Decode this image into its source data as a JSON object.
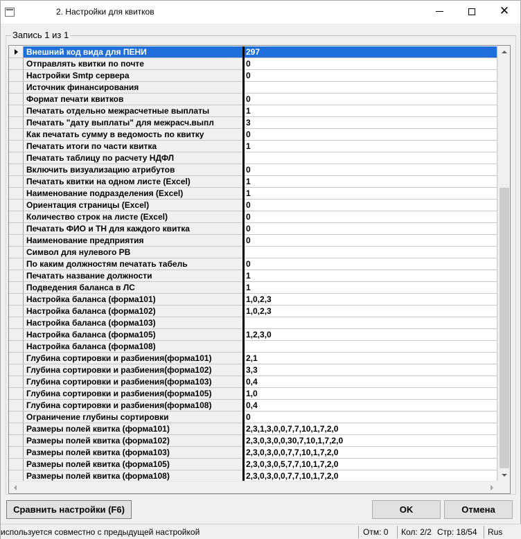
{
  "window": {
    "title": "2. Настройки для квитков"
  },
  "group": {
    "caption": "Запись 1 из 1"
  },
  "grid": {
    "rows": [
      {
        "name": "Внешний код вида для ПЕНИ",
        "value": "297"
      },
      {
        "name": "Отправлять квитки по почте",
        "value": "0"
      },
      {
        "name": "Настройки Smtp сервера",
        "value": "0"
      },
      {
        "name": "Источник финансирования",
        "value": ""
      },
      {
        "name": "Формат печати квитков",
        "value": "0"
      },
      {
        "name": "Печатать отдельно межрасчетные выплаты",
        "value": "1"
      },
      {
        "name": "Печатать \"дату выплаты\" для межрасч.выпл",
        "value": "3"
      },
      {
        "name": "Как печатать сумму в ведомость по квитку",
        "value": "0"
      },
      {
        "name": "Печатать итоги по части квитка",
        "value": "1"
      },
      {
        "name": "Печатать таблицу по расчету НДФЛ",
        "value": ""
      },
      {
        "name": "Включить визуализацию атрибутов",
        "value": "0"
      },
      {
        "name": "Печатать квитки на одном листе (Excel)",
        "value": "1"
      },
      {
        "name": "Наименование подразделения (Excel)",
        "value": "1"
      },
      {
        "name": "Ориентация страницы (Excel)",
        "value": "0"
      },
      {
        "name": "Количество строк на листе (Excel)",
        "value": "0"
      },
      {
        "name": "Печатать ФИО и ТН для каждого квитка",
        "value": "0"
      },
      {
        "name": "Наименование предприятия",
        "value": "0"
      },
      {
        "name": "Символ для нулевого РВ",
        "value": ""
      },
      {
        "name": "По каким должностям печатать табель",
        "value": "0"
      },
      {
        "name": "Печатать название должности",
        "value": "1"
      },
      {
        "name": "Подведения баланса в ЛС",
        "value": "1"
      },
      {
        "name": "Настройка баланса (форма101)",
        "value": "1,0,2,3"
      },
      {
        "name": "Настройка баланса (форма102)",
        "value": "1,0,2,3"
      },
      {
        "name": "Настройка баланса (форма103)",
        "value": ""
      },
      {
        "name": "Настройка баланса (форма105)",
        "value": "1,2,3,0"
      },
      {
        "name": "Настройка баланса (форма108)",
        "value": ""
      },
      {
        "name": "Глубина сортировки и разбиения(форма101)",
        "value": "2,1"
      },
      {
        "name": "Глубина сортировки и разбиения(форма102)",
        "value": "3,3"
      },
      {
        "name": "Глубина сортировки и разбиения(форма103)",
        "value": "0,4"
      },
      {
        "name": "Глубина сортировки и разбиения(форма105)",
        "value": "1,0"
      },
      {
        "name": "Глубина сортировки и разбиения(форма108)",
        "value": "0,4"
      },
      {
        "name": "Ограничение глубины сортировки",
        "value": "0"
      },
      {
        "name": "Размеры полей квитка (форма101)",
        "value": "2,3,1,3,0,0,7,7,10,1,7,2,0"
      },
      {
        "name": "Размеры полей квитка (форма102)",
        "value": "2,3,0,3,0,0,30,7,10,1,7,2,0"
      },
      {
        "name": "Размеры полей квитка (форма103)",
        "value": "2,3,0,3,0,0,7,7,10,1,7,2,0"
      },
      {
        "name": "Размеры полей квитка (форма105)",
        "value": "2,3,0,3,0,5,7,7,10,1,7,2,0"
      },
      {
        "name": "Размеры полей квитка (форма108)",
        "value": "2,3,0,3,0,0,7,7,10,1,7,2,0"
      }
    ]
  },
  "buttons": {
    "compare": "Сравнить настройки (F6)",
    "ok": "OK",
    "cancel": "Отмена"
  },
  "statusbar": {
    "message": "используется совместно с предыдущей настройкой",
    "mode": "Отм: 0",
    "col": "Кол: 2/2",
    "row": "Стр: 18/54",
    "lang": "Rus"
  },
  "colors": {
    "selection": "#1e6fd9",
    "window_bg": "#f0f0f0"
  },
  "icons": [
    "app-icon",
    "minimize-icon",
    "maximize-icon",
    "close-icon",
    "row-indicator-arrow-icon",
    "scroll-up-icon",
    "scroll-down-icon",
    "scroll-left-icon",
    "scroll-right-icon"
  ]
}
